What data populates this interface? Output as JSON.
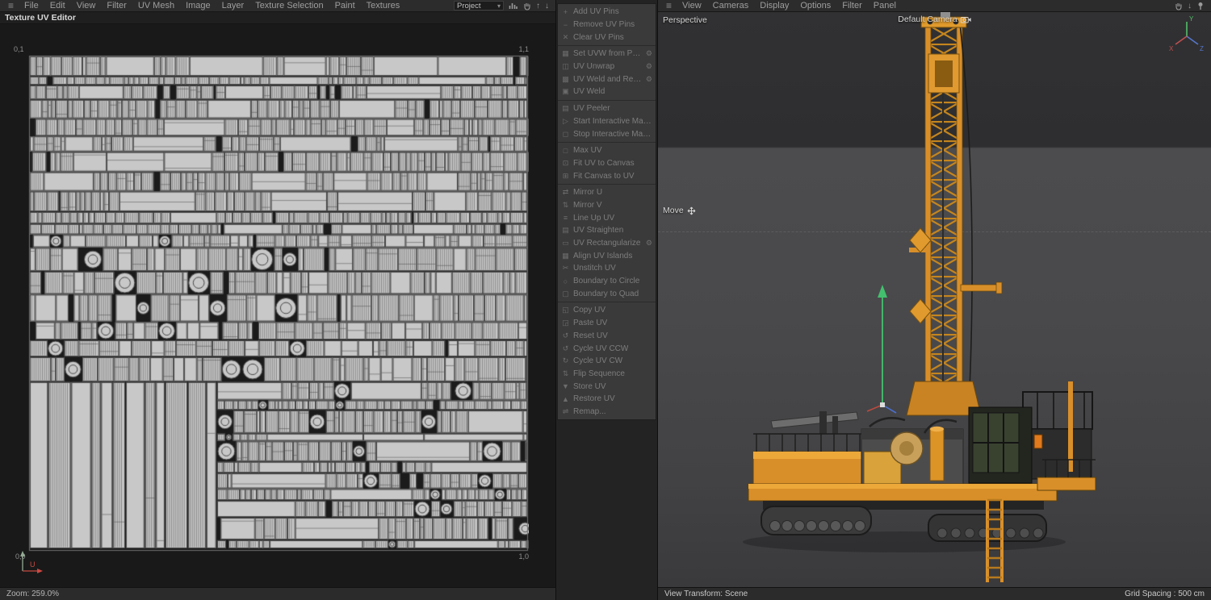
{
  "icons": {
    "hamburger": "≡",
    "caret": "▾",
    "gear": "⚙",
    "arrow_up": "↑",
    "arrow_down": "↓"
  },
  "left_panel": {
    "title": "Texture UV Editor",
    "menu": [
      "File",
      "Edit",
      "View",
      "Filter",
      "UV Mesh",
      "Image",
      "Layer",
      "Texture Selection",
      "Paint",
      "Textures"
    ],
    "project": {
      "value": "Project"
    },
    "uv_canvas": {
      "corner_top_left": "0,1",
      "corner_top_right": "1,1",
      "corner_bottom_left": "0,0",
      "corner_bottom_right": "1,0",
      "axis_label": "U"
    },
    "status": {
      "zoom": "Zoom: 259.0%"
    },
    "uv_render": {
      "seed": 1337,
      "bg": "#1b1b1b",
      "fill": "#c8c8c8",
      "stroke": "#454545"
    }
  },
  "uv_menu": {
    "items": [
      {
        "icon": "+",
        "label": "Add UV Pins"
      },
      {
        "icon": "−",
        "label": "Remove UV Pins"
      },
      {
        "icon": "✕",
        "label": "Clear UV Pins"
      },
      {
        "icon": "▦",
        "label": "Set UVW from Projection",
        "gear": true,
        "sep": true
      },
      {
        "icon": "◫",
        "label": "UV Unwrap",
        "gear": true
      },
      {
        "icon": "▩",
        "label": "UV Weld and Relax",
        "gear": true
      },
      {
        "icon": "▣",
        "label": "UV Weld"
      },
      {
        "icon": "▤",
        "label": "UV Peeler",
        "sep": true
      },
      {
        "icon": "▷",
        "label": "Start Interactive Mapping"
      },
      {
        "icon": "◻",
        "label": "Stop Interactive Mapping"
      },
      {
        "icon": "□",
        "label": "Max UV",
        "sep": true
      },
      {
        "icon": "⊡",
        "label": "Fit UV to Canvas"
      },
      {
        "icon": "⊞",
        "label": "Fit Canvas to UV"
      },
      {
        "icon": "⇄",
        "label": "Mirror U",
        "sep": true
      },
      {
        "icon": "⇅",
        "label": "Mirror V"
      },
      {
        "icon": "≡",
        "label": "Line Up UV"
      },
      {
        "icon": "▤",
        "label": "UV Straighten"
      },
      {
        "icon": "▭",
        "label": "UV Rectangularize",
        "gear": true
      },
      {
        "icon": "▦",
        "label": "Align UV Islands"
      },
      {
        "icon": "✂",
        "label": "Unstitch UV"
      },
      {
        "icon": "○",
        "label": "Boundary to Circle"
      },
      {
        "icon": "▢",
        "label": "Boundary to Quad"
      },
      {
        "icon": "◱",
        "label": "Copy UV",
        "sep": true
      },
      {
        "icon": "◲",
        "label": "Paste UV"
      },
      {
        "icon": "↺",
        "label": "Reset UV"
      },
      {
        "icon": "↺",
        "label": "Cycle UV CCW"
      },
      {
        "icon": "↻",
        "label": "Cycle UV CW"
      },
      {
        "icon": "⇅",
        "label": "Flip Sequence"
      },
      {
        "icon": "▼",
        "label": "Store UV"
      },
      {
        "icon": "▲",
        "label": "Restore UV"
      },
      {
        "icon": "⇌",
        "label": "Remap..."
      }
    ]
  },
  "right_panel": {
    "menu": [
      "View",
      "Cameras",
      "Display",
      "Options",
      "Filter",
      "Panel"
    ],
    "labels": {
      "view_name": "Perspective",
      "camera": "Default Camera",
      "tool": "Move"
    },
    "axis_gizmo": {
      "x": "X",
      "y": "Y",
      "z": "Z"
    },
    "status": {
      "view_transform": "View Transform: Scene",
      "grid_spacing": "Grid Spacing : 500 cm"
    }
  },
  "colors": {
    "rig_orange": "#d98f29",
    "gizmo_green": "#43c06e",
    "axis_red": "#c05050",
    "axis_blue": "#5577cc"
  }
}
